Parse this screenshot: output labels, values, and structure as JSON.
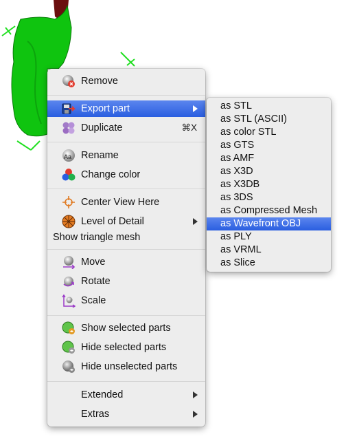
{
  "context_menu": {
    "items": [
      {
        "label": "Remove",
        "icon": "remove-icon"
      },
      {
        "label": "Export part",
        "icon": "export-icon",
        "highlighted": true,
        "submenu": true
      },
      {
        "label": "Duplicate",
        "icon": "duplicate-icon",
        "shortcut": "⌘X"
      },
      {
        "label": "Rename",
        "icon": "rename-icon"
      },
      {
        "label": "Change color",
        "icon": "color-palette-icon"
      },
      {
        "label": "Center View Here",
        "icon": "crosshair-icon"
      },
      {
        "label": "Level of Detail",
        "icon": "level-of-detail-icon",
        "submenu": true
      },
      {
        "label": "Show triangle mesh"
      },
      {
        "label": "Move",
        "icon": "move-icon"
      },
      {
        "label": "Rotate",
        "icon": "rotate-icon"
      },
      {
        "label": "Scale",
        "icon": "scale-icon"
      },
      {
        "label": "Show selected parts",
        "icon": "show-parts-icon"
      },
      {
        "label": "Hide selected parts",
        "icon": "hide-parts-icon"
      },
      {
        "label": "Hide unselected parts",
        "icon": "hide-unselected-icon"
      },
      {
        "label": "Extended",
        "submenu": true
      },
      {
        "label": "Extras",
        "submenu": true
      }
    ]
  },
  "export_submenu": {
    "items": [
      "as STL",
      "as STL (ASCII)",
      "as color STL",
      "as GTS",
      "as AMF",
      "as X3D",
      "as X3DB",
      "as 3DS",
      "as Compressed Mesh",
      "as Wavefront OBJ",
      "as PLY",
      "as VRML",
      "as Slice"
    ],
    "highlighted": "as Wavefront OBJ"
  },
  "colors": {
    "highlight": "#3a6ee6",
    "model_green": "#0fc40f",
    "model_dark_red": "#6b0f0f",
    "menu_background": "#ededed"
  }
}
